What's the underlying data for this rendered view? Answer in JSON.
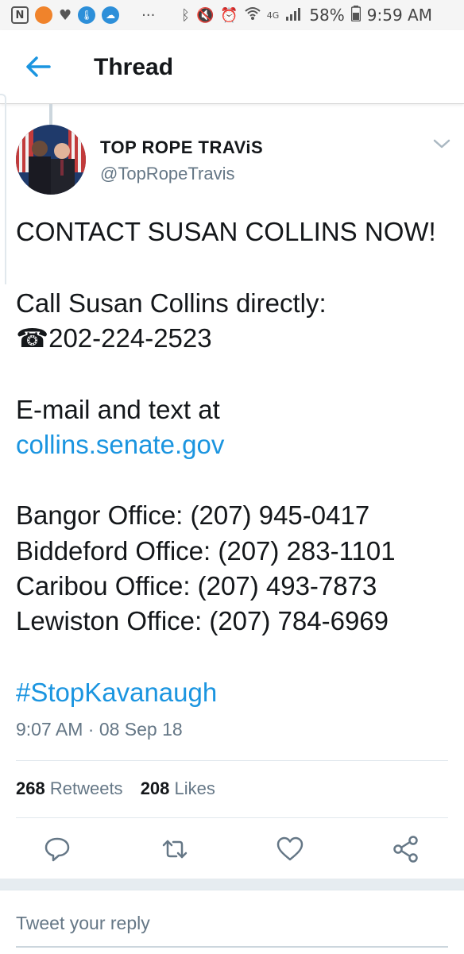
{
  "status_bar": {
    "square_icon_label": "N",
    "dots": "···",
    "network": "4G",
    "battery": "58%",
    "time": "9:59 AM"
  },
  "header": {
    "title": "Thread"
  },
  "tweet": {
    "author_name": "TOP ROPE TRAViS",
    "author_handle": "@TopRopeTravis",
    "lines": {
      "l1": "CONTACT SUSAN COLLINS NOW!",
      "l2": "Call Susan Collins directly:",
      "l3": "☎202-224-2523",
      "l4": "E-mail and text at",
      "l5_link": "collins.senate.gov",
      "l6": "Bangor Office: (207) 945-0417",
      "l7": "Biddeford Office: (207) 283-1101",
      "l8": "Caribou Office: (207) 493-7873",
      "l9": "Lewiston Office: (207) 784-6969",
      "hashtag": "#StopKavanaugh"
    },
    "timestamp": "9:07 AM · 08 Sep 18",
    "retweets_count": "268",
    "retweets_label": "Retweets",
    "likes_count": "208",
    "likes_label": "Likes"
  },
  "reply": {
    "placeholder": "Tweet your reply"
  },
  "colors": {
    "accent": "#1b95e0",
    "secondary_text": "#657786"
  }
}
